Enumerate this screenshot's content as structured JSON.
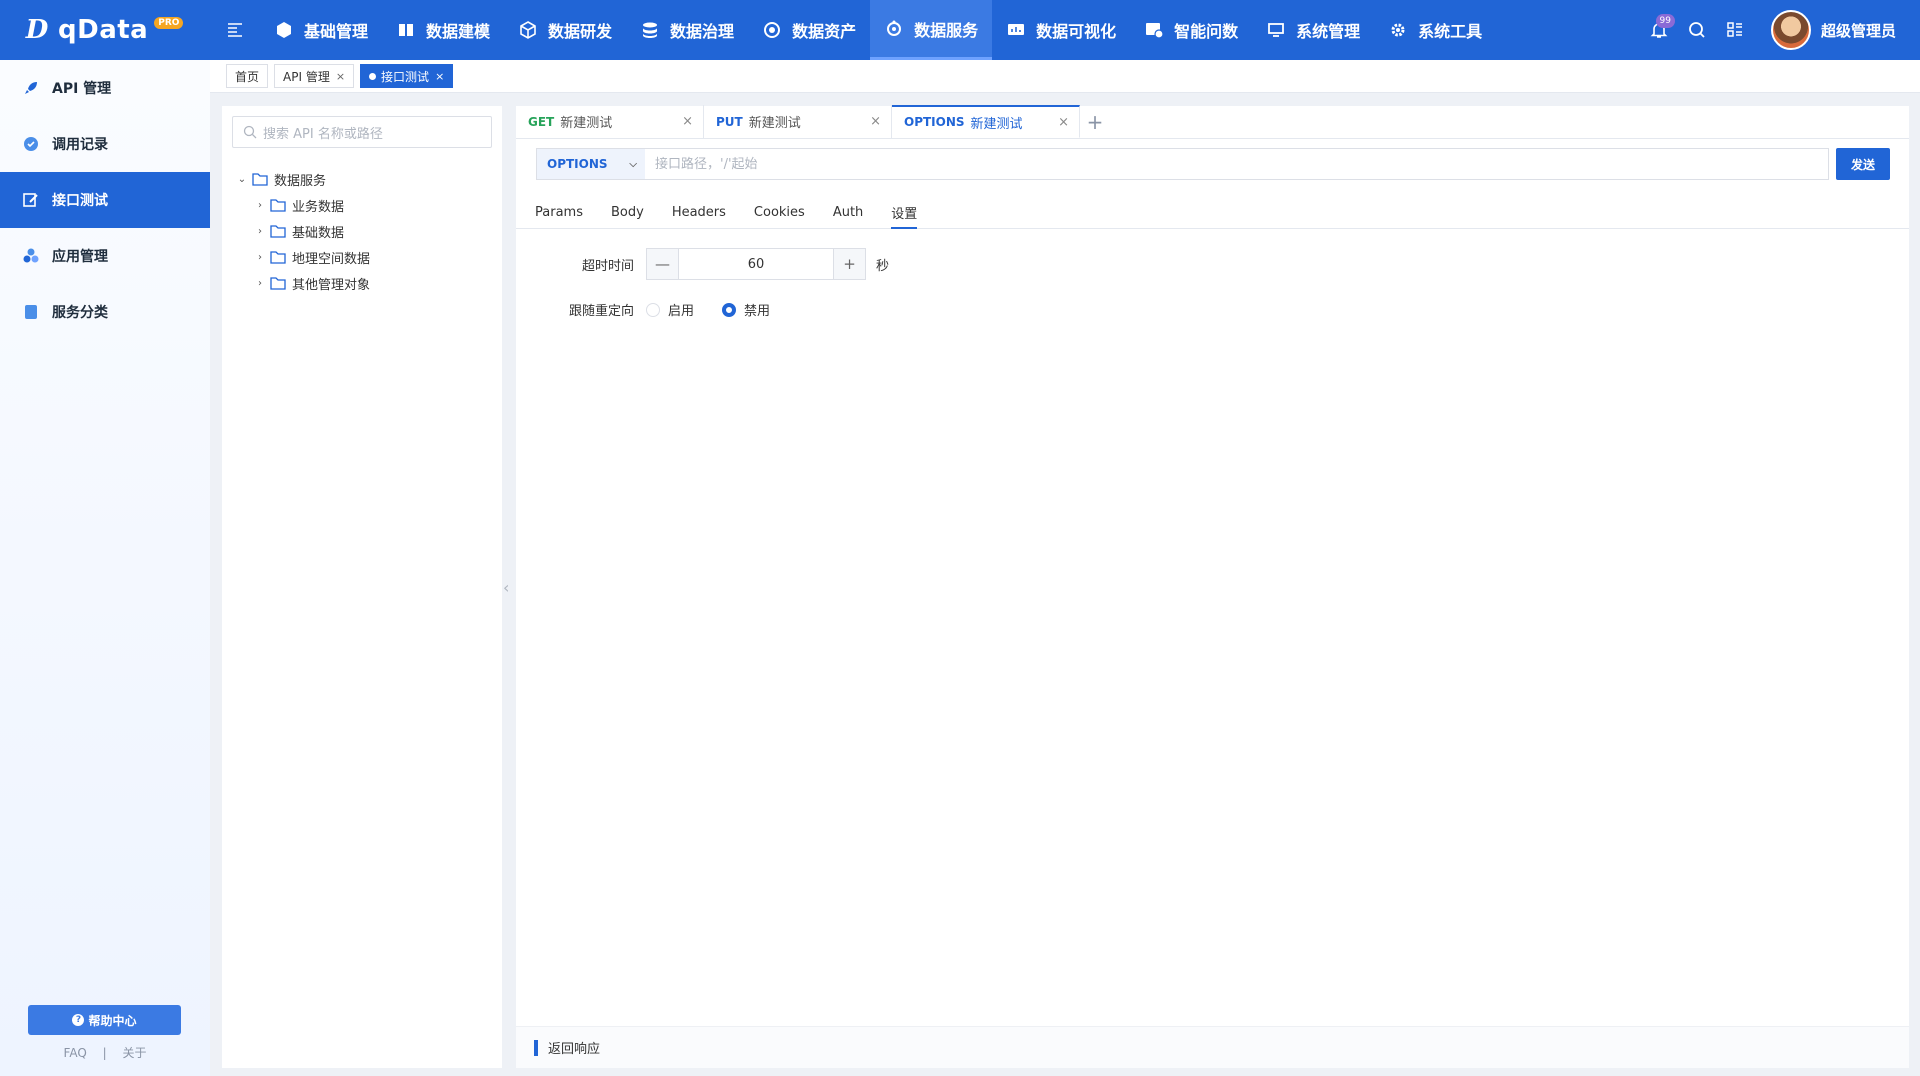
{
  "brand": {
    "name": "qData",
    "badge": "PRO"
  },
  "nav": [
    {
      "label": "基础管理",
      "icon": "cube-icon"
    },
    {
      "label": "数据建模",
      "icon": "book-icon"
    },
    {
      "label": "数据研发",
      "icon": "box-icon"
    },
    {
      "label": "数据治理",
      "icon": "database-icon"
    },
    {
      "label": "数据资产",
      "icon": "target-icon"
    },
    {
      "label": "数据服务",
      "icon": "service-icon",
      "active": true
    },
    {
      "label": "数据可视化",
      "icon": "chart-icon"
    },
    {
      "label": "智能问数",
      "icon": "ai-icon"
    },
    {
      "label": "系统管理",
      "icon": "monitor-icon"
    },
    {
      "label": "系统工具",
      "icon": "gear-icon"
    }
  ],
  "header": {
    "notification_count": "99",
    "username": "超级管理员"
  },
  "sidebar": {
    "items": [
      {
        "label": "API 管理",
        "icon": "rocket-icon"
      },
      {
        "label": "调用记录",
        "icon": "record-icon"
      },
      {
        "label": "接口测试",
        "icon": "edit-icon",
        "active": true
      },
      {
        "label": "应用管理",
        "icon": "apps-icon"
      },
      {
        "label": "服务分类",
        "icon": "category-icon"
      }
    ],
    "help": "帮助中心",
    "faq": "FAQ",
    "sep": "|",
    "about": "关于"
  },
  "crumbs": [
    {
      "label": "首页"
    },
    {
      "label": "API 管理",
      "close": "×"
    },
    {
      "label": "接口测试",
      "close": "×",
      "active": true
    }
  ],
  "tree": {
    "search_placeholder": "搜索 API 名称或路径",
    "root": {
      "label": "数据服务",
      "caret": "⌄"
    },
    "children": [
      {
        "label": "业务数据",
        "caret": "›"
      },
      {
        "label": "基础数据",
        "caret": "›"
      },
      {
        "label": "地理空间数据",
        "caret": "›"
      },
      {
        "label": "其他管理对象",
        "caret": "›"
      }
    ]
  },
  "request_tabs": [
    {
      "method": "GET",
      "name": "新建测试",
      "close": "×"
    },
    {
      "method": "PUT",
      "name": "新建测试",
      "close": "×"
    },
    {
      "method": "OPTIONS",
      "name": "新建测试",
      "close": "×",
      "active": true
    }
  ],
  "add_tab": "+",
  "url_bar": {
    "method": "OPTIONS",
    "url_value": "",
    "placeholder": "接口路径，'/'起始",
    "send": "发送"
  },
  "sub_tabs": [
    "Params",
    "Body",
    "Headers",
    "Cookies",
    "Auth",
    "设置"
  ],
  "active_sub_tab": "设置",
  "settings": {
    "timeout_label": "超时时间",
    "timeout_value": "60",
    "timeout_unit": "秒",
    "redirect_label": "跟随重定向",
    "redirect_options": [
      "启用",
      "禁用"
    ],
    "redirect_selected": "禁用"
  },
  "response": {
    "label": "返回响应"
  },
  "colors": {
    "primary": "#2165d6",
    "get": "#27a35a",
    "badge": "#f5a623"
  }
}
